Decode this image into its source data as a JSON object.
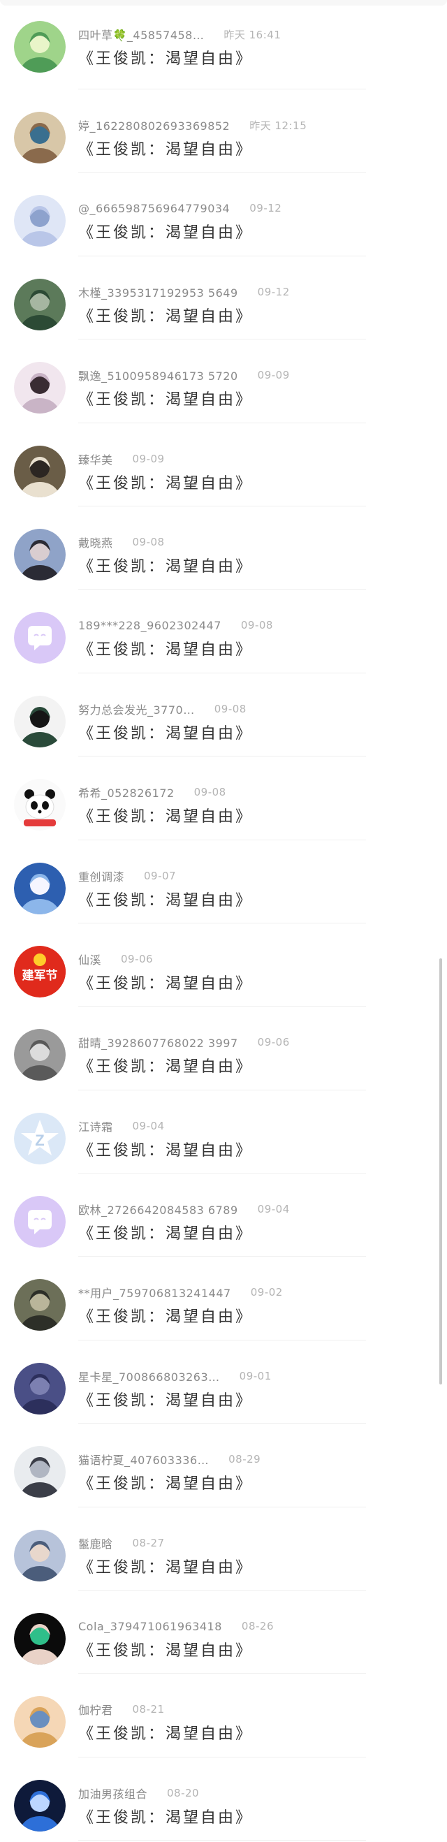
{
  "message_text": "《王俊凯：渴望自由》",
  "items": [
    {
      "name": "四叶草🍀_45857458…",
      "time": "昨天 16:41",
      "avatar": {
        "icon": "forest-path-photo",
        "colors": [
          "#9fd48a",
          "#4f9c57",
          "#e9f5c9"
        ]
      }
    },
    {
      "name": "婷_162280802693369852",
      "time": "昨天 12:15",
      "avatar": {
        "icon": "person-with-hat-photo",
        "colors": [
          "#d8c7a8",
          "#8a6a4c",
          "#3a6f8f"
        ]
      }
    },
    {
      "name": "@_666598756964779034",
      "time": "09-12",
      "avatar": {
        "icon": "girl-light-blue-photo",
        "colors": [
          "#dfe6f6",
          "#b9c6e8",
          "#8da2cd"
        ]
      }
    },
    {
      "name": "木槿_3395317192953 5649",
      "time": "09-12",
      "avatar": {
        "icon": "girl-in-forest-photo",
        "colors": [
          "#5c7a5a",
          "#2c4a35",
          "#a6b6a1"
        ]
      }
    },
    {
      "name": "飘逸_5100958946173 5720",
      "time": "09-09",
      "avatar": {
        "icon": "girl-portrait-photo",
        "colors": [
          "#f1e6ee",
          "#c9b4c6",
          "#3a2c33"
        ]
      }
    },
    {
      "name": "臻华美",
      "time": "09-09",
      "avatar": {
        "icon": "woman-selfie-photo",
        "colors": [
          "#6a5d47",
          "#e9e0cf",
          "#2c2622"
        ]
      }
    },
    {
      "name": "戴晓燕",
      "time": "09-08",
      "avatar": {
        "icon": "long-hair-girl-photo",
        "colors": [
          "#8fa3c8",
          "#2b2b35",
          "#d9cdd0"
        ]
      }
    },
    {
      "name": "189***228_9602302447",
      "time": "09-08",
      "avatar": {
        "icon": "default-chat-bubble-icon",
        "colors": [
          "#d9c8f7",
          "#ffffff"
        ]
      }
    },
    {
      "name": "努力总会发光_3770…",
      "time": "09-08",
      "avatar": {
        "icon": "cartoon-girl-photo",
        "colors": [
          "#f3f3f3",
          "#2a4a3a",
          "#151515"
        ]
      }
    },
    {
      "name": "希希_052826172",
      "time": "09-08",
      "avatar": {
        "icon": "panda-cartoon-icon",
        "colors": [
          "#fafafa",
          "#111111",
          "#e43b3b"
        ]
      }
    },
    {
      "name": "重创调漆",
      "time": "09-07",
      "avatar": {
        "icon": "night-sky-photo",
        "colors": [
          "#2d5fb0",
          "#8cb6ea",
          "#f5f5ff"
        ]
      }
    },
    {
      "name": "仙溪",
      "time": "09-06",
      "avatar": {
        "icon": "army-day-banner",
        "text": "建军节",
        "colors": [
          "#e02a1c",
          "#ffcc2a",
          "#ffffff"
        ]
      }
    },
    {
      "name": "甜晴_3928607768022 3997",
      "time": "09-06",
      "avatar": {
        "icon": "grayscale-portrait-photo",
        "colors": [
          "#9a9a9a",
          "#5a5a5a",
          "#dcdcdc"
        ]
      }
    },
    {
      "name": "江诗霜",
      "time": "09-04",
      "avatar": {
        "icon": "default-star-q-icon",
        "colors": [
          "#dbe8f7",
          "#ffffff",
          "#b8cfe9"
        ]
      }
    },
    {
      "name": "欧林_2726642084583 6789",
      "time": "09-04",
      "avatar": {
        "icon": "default-chat-bubble-icon",
        "colors": [
          "#d9c8f7",
          "#ffffff"
        ]
      }
    },
    {
      "name": "**用户_759706813241447",
      "time": "09-02",
      "avatar": {
        "icon": "man-in-coat-photo",
        "colors": [
          "#6c6f58",
          "#2d2f28",
          "#b9b59a"
        ]
      }
    },
    {
      "name": "星卡星_700866803263…",
      "time": "09-01",
      "avatar": {
        "icon": "dark-blue-texture-photo",
        "colors": [
          "#4a4f86",
          "#2c2f5c",
          "#7c80b1"
        ]
      }
    },
    {
      "name": "猫语柠夏_407603336…",
      "time": "08-29",
      "avatar": {
        "icon": "girl-profile-photo",
        "colors": [
          "#e9ecef",
          "#3b3e48",
          "#b0b6c2"
        ]
      }
    },
    {
      "name": "鬣鹿晗",
      "time": "08-27",
      "avatar": {
        "icon": "cartoon-boy-photo",
        "colors": [
          "#b7c3da",
          "#4b5d7b",
          "#e8d7cc"
        ]
      }
    },
    {
      "name": "Cola_379471061963418",
      "time": "08-26",
      "avatar": {
        "icon": "green-eye-girl-photo",
        "colors": [
          "#0b0b0b",
          "#e9d2c7",
          "#2fbf8a"
        ]
      }
    },
    {
      "name": "伽柠君",
      "time": "08-21",
      "avatar": {
        "icon": "princess-cartoon-photo",
        "colors": [
          "#f5d7b6",
          "#d9a35a",
          "#6a8fbf"
        ]
      }
    },
    {
      "name": "加油男孩组合",
      "time": "08-20",
      "avatar": {
        "icon": "stage-lights-photo",
        "colors": [
          "#0e1a3a",
          "#2d6fd8",
          "#bcd6ff"
        ]
      }
    }
  ]
}
